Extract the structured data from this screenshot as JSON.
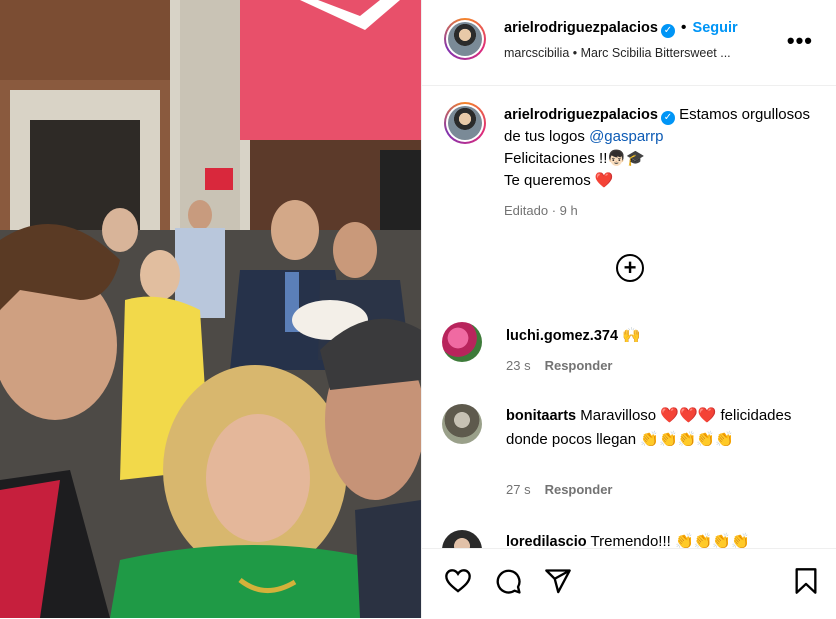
{
  "post": {
    "author": "arielrodriguezpalacios",
    "follow_label": "Seguir",
    "separator": "•",
    "audio": "marcscibilia • Marc Scibilia Bittersweet ...",
    "more_icon": "more-horizontal-icon"
  },
  "caption": {
    "author": "arielrodriguezpalacios",
    "text_1": "Estamos orgullosos de tus logos",
    "mention": "@gasparrp",
    "line_2": "Felicitaciones !!👦🏻🎓",
    "line_3": "Te queremos ❤️",
    "meta": "Editado · 9 h"
  },
  "comments": [
    {
      "user": "luchi.gomez.374",
      "text": "🙌",
      "time": "23 s",
      "reply": "Responder"
    },
    {
      "user": "bonitaarts",
      "text": "Maravilloso ❤️❤️❤️ felicidades donde pocos llegan 👏👏👏👏👏",
      "time": "27 s",
      "reply": "Responder"
    },
    {
      "user": "loredilascio",
      "text": "Tremendo!!! 👏👏👏👏"
    }
  ],
  "footer": {
    "icons": [
      "heart-icon",
      "comment-icon",
      "share-icon",
      "bookmark-icon"
    ]
  },
  "colors": {
    "accent": "#0095f6",
    "mention": "#0d5bb5",
    "muted": "#737373",
    "heart": "#e0112b"
  }
}
